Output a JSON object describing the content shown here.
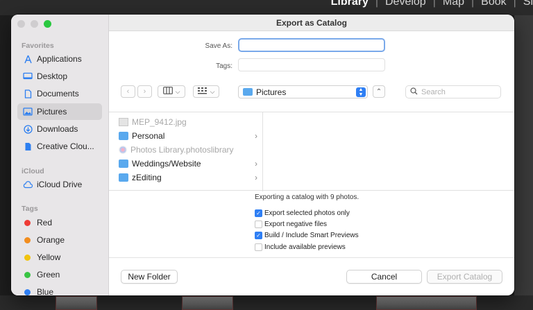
{
  "background": {
    "modules": [
      "Library",
      "Develop",
      "Map",
      "Book",
      "Sl"
    ],
    "active_module": "Library"
  },
  "dialog": {
    "title": "Export as Catalog",
    "save_as_label": "Save As:",
    "save_as_value": "",
    "tags_label": "Tags:",
    "location": "Pictures",
    "search_placeholder": "Search"
  },
  "sidebar": {
    "favorites_header": "Favorites",
    "favorites": [
      {
        "label": "Applications",
        "icon": "applications-icon"
      },
      {
        "label": "Desktop",
        "icon": "desktop-icon"
      },
      {
        "label": "Documents",
        "icon": "document-icon"
      },
      {
        "label": "Pictures",
        "icon": "pictures-icon",
        "selected": true
      },
      {
        "label": "Downloads",
        "icon": "download-icon"
      },
      {
        "label": "Creative Clou...",
        "icon": "file-icon"
      }
    ],
    "icloud_header": "iCloud",
    "icloud": [
      {
        "label": "iCloud Drive",
        "icon": "cloud-icon"
      }
    ],
    "tags_header": "Tags",
    "tags": [
      {
        "label": "Red",
        "color": "#ee3b35"
      },
      {
        "label": "Orange",
        "color": "#f28d1e"
      },
      {
        "label": "Yellow",
        "color": "#f1c40f"
      },
      {
        "label": "Green",
        "color": "#39c443"
      },
      {
        "label": "Blue",
        "color": "#2f7ff4"
      }
    ]
  },
  "files": [
    {
      "name": "MEP_9412.jpg",
      "type": "jpg",
      "dim": true,
      "folder": false
    },
    {
      "name": "Personal",
      "type": "folder",
      "dim": false,
      "folder": true
    },
    {
      "name": "Photos Library.photoslibrary",
      "type": "library",
      "dim": true,
      "folder": false
    },
    {
      "name": "Weddings/Website",
      "type": "folder",
      "dim": false,
      "folder": true
    },
    {
      "name": "zEditing",
      "type": "folder",
      "dim": false,
      "folder": true
    }
  ],
  "options": {
    "info": "Exporting a catalog with 9 photos.",
    "export_selected": {
      "label": "Export selected photos only",
      "checked": true
    },
    "export_negatives": {
      "label": "Export negative files",
      "checked": false
    },
    "smart_previews": {
      "label": "Build / Include Smart Previews",
      "checked": true
    },
    "include_previews": {
      "label": "Include available previews",
      "checked": false
    }
  },
  "buttons": {
    "new_folder": "New Folder",
    "cancel": "Cancel",
    "export": "Export Catalog"
  }
}
